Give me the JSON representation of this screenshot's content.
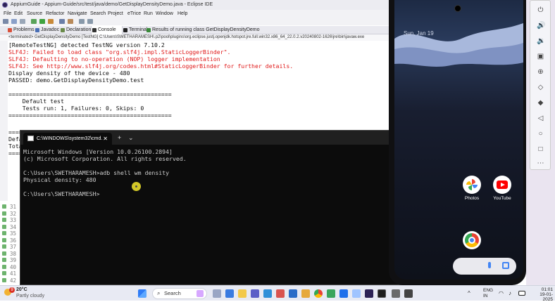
{
  "eclipse": {
    "title": "AppiumGuide - Appium-Guide/src/test/java/demo/GetDisplayDensityDemo.java - Eclipse IDE",
    "menu": [
      "File",
      "Edit",
      "Source",
      "Refactor",
      "Navigate",
      "Search",
      "Project",
      "eTrice",
      "Run",
      "Window",
      "Help"
    ],
    "tabs": [
      {
        "label": "Problems"
      },
      {
        "label": "Javadoc"
      },
      {
        "label": "Declaration"
      },
      {
        "label": "Console"
      },
      {
        "label": "Terminal"
      },
      {
        "label": "Results of running class GetDisplayDensityDemo"
      }
    ],
    "console_status": "<terminated> GetDisplayDensityDemo [TestNG] C:\\Users\\SWETHARAMESH\\.p2\\pool\\plugins\\org.eclipse.justj.openjdk.hotspot.jre.full.win32.x86_64_22.0.2.v20240802-1626\\jre\\bin\\javaw.exe",
    "console_lines": [
      {
        "text": "[RemoteTestNG] detected TestNG version 7.10.2",
        "error": false
      },
      {
        "text": "SLF4J: Failed to load class \"org.slf4j.impl.StaticLoggerBinder\".",
        "error": true
      },
      {
        "text": "SLF4J: Defaulting to no-operation (NOP) logger implementation",
        "error": true
      },
      {
        "text": "SLF4J: See http://www.slf4j.org/codes.html#StaticLoggerBinder for further details.",
        "error": true
      },
      {
        "text": "Display density of the device - 480",
        "error": false
      },
      {
        "text": "PASSED: demo.GetDisplayDensityDemo.test",
        "error": false
      },
      {
        "text": "",
        "error": false
      },
      {
        "text": "===============================================",
        "error": false
      },
      {
        "text": "    Default test",
        "error": false
      },
      {
        "text": "    Tests run: 1, Failures: 0, Skips: 0",
        "error": false
      },
      {
        "text": "===============================================",
        "error": false
      }
    ],
    "console_hidden_lines": [
      "====",
      "Defa",
      "Tota",
      "===="
    ],
    "line_numbers": [
      "31",
      "32",
      "33",
      "34",
      "35",
      "36",
      "37",
      "38",
      "39",
      "40",
      "41",
      "42"
    ]
  },
  "cmd": {
    "tab_title": "C:\\WINDOWS\\system32\\cmd.",
    "new_tab": "+",
    "dropdown": "⌄",
    "minimize": "—",
    "maximize": "☐",
    "close": "✕",
    "lines": [
      "Microsoft Windows [Version 10.0.26100.2894]",
      "(c) Microsoft Corporation. All rights reserved.",
      "",
      "C:\\Users\\SWETHARAMESH>adb shell wm density",
      "Physical density: 480",
      "",
      "C:\\Users\\SWETHARAMESH>"
    ]
  },
  "phone": {
    "date": "Sun, Jan 19",
    "apps": [
      {
        "label": "Photos",
        "color": "#ffffff"
      },
      {
        "label": "YouTube",
        "color": "#ff0000"
      }
    ],
    "dock_app": "chrome-icon"
  },
  "taskbar": {
    "temp": "20°C",
    "weather": "Partly cloudy",
    "badge": "9",
    "search": "Search",
    "lang1": "ENG",
    "lang2": "IN",
    "time": "01:01",
    "date": "19-01-2025"
  },
  "colors": {
    "console_error": "#e01919",
    "cmd_bg": "#0c0c0c",
    "cursor_highlight": "#e8dc2a"
  }
}
